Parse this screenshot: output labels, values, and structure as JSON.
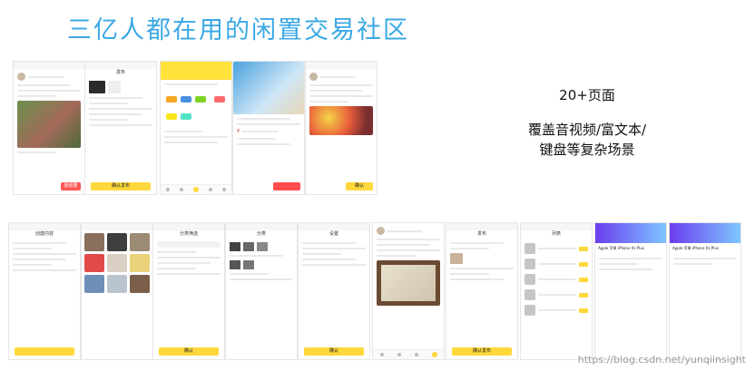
{
  "headline": "三亿人都在用的闲置交易社区",
  "stats": {
    "pages": "20+页面",
    "coverage": "覆盖音视频/富文本/\n键盘等复杂场景"
  },
  "watermark": "https://blog.csdn.net/yunqiinsight",
  "screens": {
    "publish_button": "确认发布",
    "confirm_button": "确认",
    "buy_button": "我想要",
    "phone_model": "Apple 苹果 iPhone Xs Plus"
  },
  "colors": {
    "headline": "#3ba8e4",
    "accent": "#ffd83b",
    "price": "#e4393c"
  }
}
